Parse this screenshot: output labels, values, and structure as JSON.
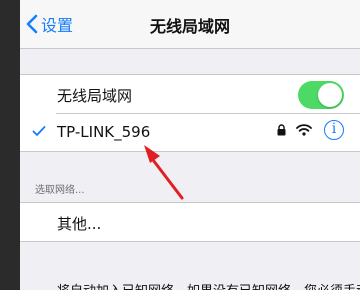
{
  "navbar": {
    "back_label": "设置",
    "title": "无线局域网"
  },
  "wifi_toggle_row": {
    "label": "无线局域网",
    "toggle_on": true,
    "toggle_color": "#4cd964"
  },
  "connected_network": {
    "name": "TP-LINK_596",
    "locked": true,
    "icons": [
      "checkmark-icon",
      "lock-icon",
      "wifi-icon",
      "info-icon"
    ]
  },
  "choose_network": {
    "header": "选取网络...",
    "other_label": "其他..."
  },
  "footer": {
    "text": "将自动加入已知网络。如果没有已知网络，您必须手动选择一个网络。"
  },
  "colors": {
    "accent": "#147efb",
    "annotation_arrow": "#e02020"
  }
}
